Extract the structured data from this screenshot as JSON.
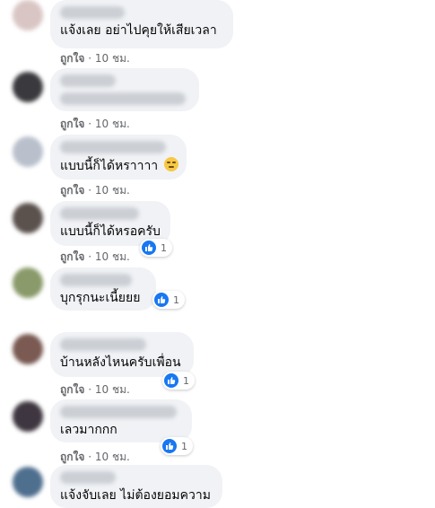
{
  "ui": {
    "like_label": "ถูกใจ",
    "dot": "·",
    "accent_color": "#1877f2",
    "reaction_icon": "thumbs-up-icon"
  },
  "comments": [
    {
      "text": "แจ้งเลย อย่าไปคุยให้เสียเวลา",
      "time": "10 ชม.",
      "reactions": null
    },
    {
      "text": "",
      "time": "10 ชม.",
      "reactions": null
    },
    {
      "text": "แบบนี้ก็ได้หราาาา",
      "time": "10 ชม.",
      "reactions": null,
      "emoji": "expressionless-face-emoji"
    },
    {
      "text": "แบบนี้ก็ได้หรอครับ",
      "time": "10 ชม.",
      "reactions": "1"
    },
    {
      "text": "บุกรุกนะเนี้ยยย",
      "time": "",
      "reactions": "1"
    },
    {
      "text": "บ้านหลังไหนครับเพื่อน",
      "time": "10 ชม.",
      "reactions": "1"
    },
    {
      "text": "เลวมากกก",
      "time": "10 ชม.",
      "reactions": "1"
    },
    {
      "text": "แจ้งจับเลย ไม่ต้องยอมความ",
      "time": "",
      "reactions": null
    }
  ]
}
